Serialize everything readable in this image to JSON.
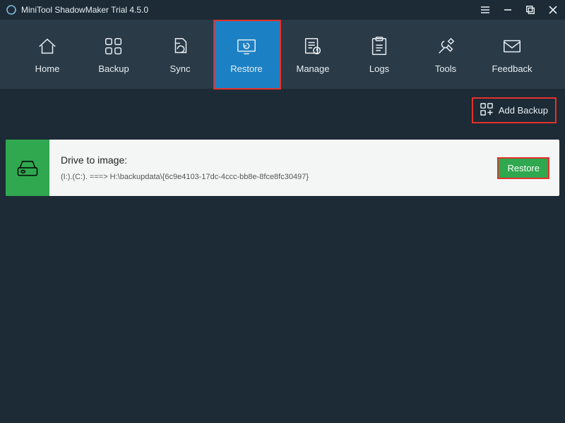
{
  "titlebar": {
    "title": "MiniTool ShadowMaker Trial 4.5.0"
  },
  "nav": {
    "items": [
      {
        "label": "Home"
      },
      {
        "label": "Backup"
      },
      {
        "label": "Sync"
      },
      {
        "label": "Restore"
      },
      {
        "label": "Manage"
      },
      {
        "label": "Logs"
      },
      {
        "label": "Tools"
      },
      {
        "label": "Feedback"
      }
    ]
  },
  "actions": {
    "add_backup": "Add Backup"
  },
  "card": {
    "title": "Drive to image:",
    "path": "(I:).(C:). ===> H:\\backupdata\\{6c9e4103-17dc-4ccc-bb8e-8fce8fc30497}",
    "restore_label": "Restore"
  },
  "colors": {
    "accent": "#1c81c4",
    "success": "#2fa84f",
    "highlight": "#e4312b",
    "bg": "#1c2b36",
    "nav": "#2a3a47"
  }
}
